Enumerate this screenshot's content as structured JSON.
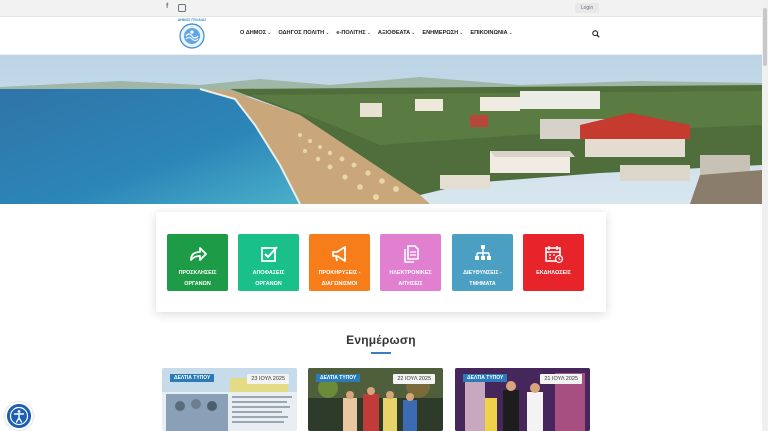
{
  "topbar": {
    "facebook_icon": "facebook-icon",
    "instagram_icon": "instagram-icon",
    "login_label": "Login"
  },
  "navbar": {
    "logo_text": "ΔΗΜΟΣ ΠΥΛΑΙΑΣ",
    "items": [
      {
        "label": "Ο ΔΗΜΟΣ"
      },
      {
        "label": "ΟΔΗΓΟΣ ΠΟΛΙΤΗ"
      },
      {
        "label": "e-ΠΟΛΙΤΗΣ"
      },
      {
        "label": "ΑΞΙΟΘΕΑΤΑ"
      },
      {
        "label": "ΕΝΗΜΕΡΩΣΗ"
      },
      {
        "label": "ΕΠΙΚΟΙΝΩΝΙΑ"
      }
    ]
  },
  "tiles": [
    {
      "label": "ΠΡΟΣΚΛΗΣΕΙΣ ΟΡΓΑΝΩΝ",
      "color": "#1d9b47",
      "icon": "share-arrow-icon"
    },
    {
      "label": "ΑΠΟΦΑΣΕΙΣ ΟΡΓΑΝΩΝ",
      "color": "#19c08a",
      "icon": "checkbox-icon"
    },
    {
      "label": "ΠΡΟΚΗΡΥΞΕΙΣ - ΔΙΑΓΩΝΙΣΜΟΙ",
      "color": "#f77d1b",
      "icon": "megaphone-icon"
    },
    {
      "label": "ΗΛΕΚΤΡΟΝΙΚΕΣ ΑΙΤΗΣΕΙΣ",
      "color": "#e17fd0",
      "icon": "documents-icon"
    },
    {
      "label": "ΔΙΕΥΘΥΝΣΕΙΣ - ΤΜΗΜΑΤΑ",
      "color": "#4a9fc3",
      "icon": "org-chart-icon"
    },
    {
      "label": "ΕΚΔΗΛΩΣΕΙΣ",
      "color": "#e8242b",
      "icon": "calendar-icon"
    }
  ],
  "section": {
    "title": "Ενημέρωση"
  },
  "news": [
    {
      "category": "ΔΕΛΤΙΑ ΤΥΠΟΥ",
      "date": "23 ΙΟΥΛ 2025"
    },
    {
      "category": "ΔΕΛΤΙΑ ΤΥΠΟΥ",
      "date": "22 ΙΟΥΛ 2025"
    },
    {
      "category": "ΔΕΛΤΙΑ ΤΥΠΟΥ",
      "date": "21 ΙΟΥΛ 2025"
    }
  ],
  "accessibility": {
    "icon": "accessibility-icon"
  }
}
